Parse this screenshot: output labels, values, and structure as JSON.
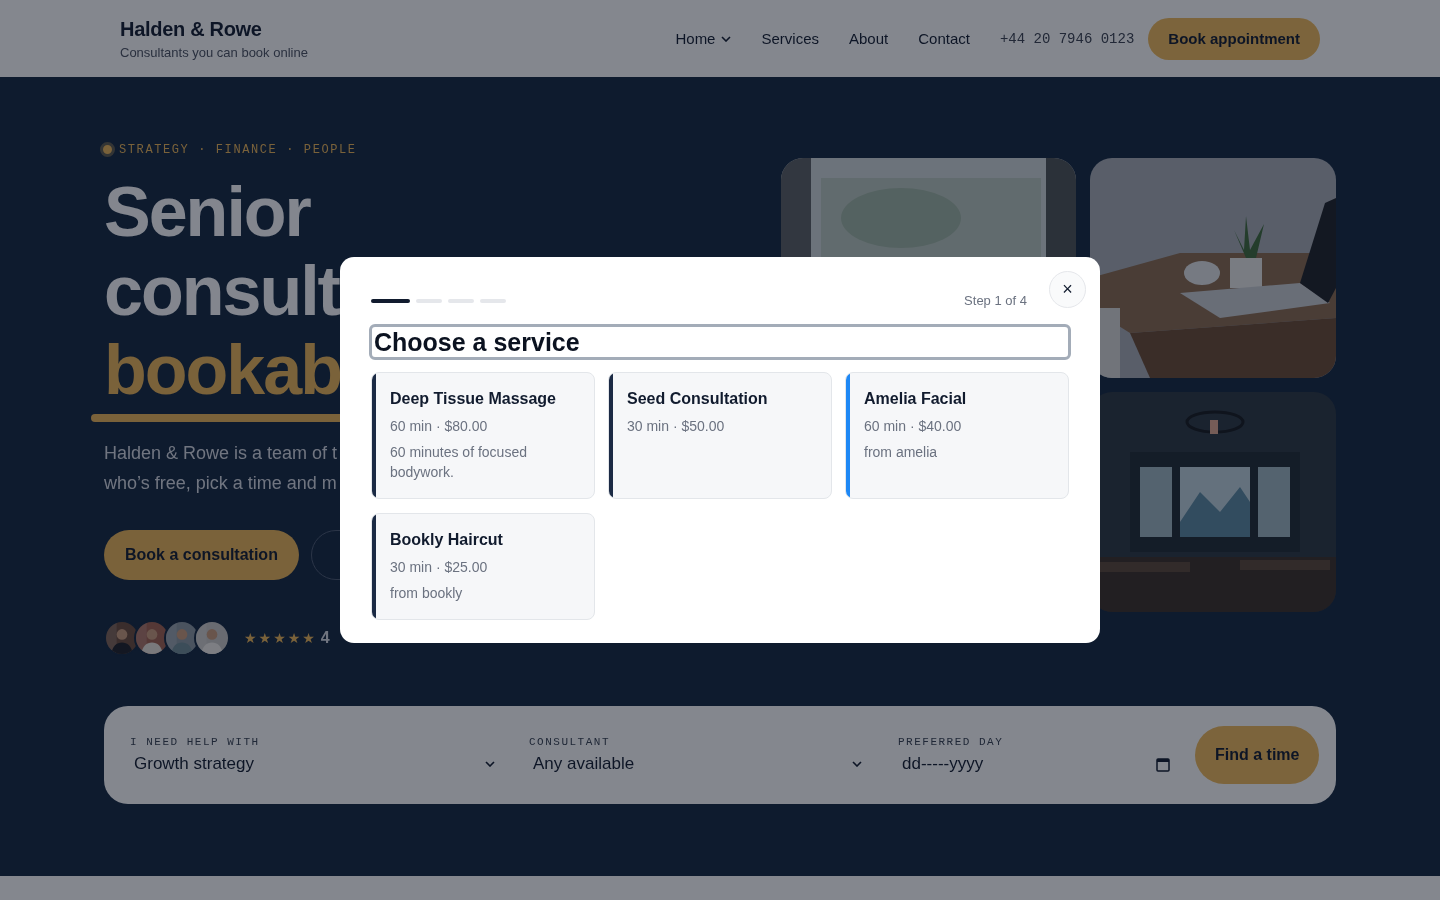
{
  "header": {
    "brand": "Halden & Rowe",
    "tagline": "Consultants you can book online",
    "nav": [
      {
        "label": "Home",
        "has_menu": true
      },
      {
        "label": "Services",
        "has_menu": false
      },
      {
        "label": "About",
        "has_menu": false
      },
      {
        "label": "Contact",
        "has_menu": false
      }
    ],
    "phone": "+44 20 7946 0123",
    "cta": "Book appointment"
  },
  "hero": {
    "eyebrow": "STRATEGY · FINANCE · PEOPLE",
    "title_lines": [
      "Senior",
      "consult"
    ],
    "title_accent": "bookab",
    "intro_lines": [
      "Halden & Rowe is a team of t",
      "who’s free, pick a time and m"
    ],
    "buttons": [
      {
        "label": "Book a consultation",
        "kind": "primary"
      },
      {
        "kind": "outline"
      }
    ],
    "reviewers": [
      {
        "kind": "picture"
      },
      {
        "kind": "picture"
      },
      {
        "kind": "picture"
      },
      {
        "kind": "picture"
      }
    ],
    "rating": {
      "stars": 5,
      "score": "4"
    },
    "photos": [
      {
        "kind": "picture"
      },
      {
        "kind": "picture"
      },
      {
        "kind": "picture"
      }
    ]
  },
  "search_bar": {
    "fields": [
      {
        "kind": "select",
        "label": "I NEED HELP WITH",
        "value": "Growth strategy"
      },
      {
        "kind": "select",
        "label": "CONSULTANT",
        "value": "Any available"
      },
      {
        "kind": "date",
        "label": "PREFERRED DAY",
        "value": "dd-----yyyy"
      }
    ],
    "button": "Find a time"
  },
  "modal": {
    "progress": [
      {
        "active": true
      },
      {
        "active": false
      },
      {
        "active": false
      },
      {
        "active": false
      }
    ],
    "step": "Step 1 of 4",
    "close": "×",
    "heading": {
      "text": "Choose a service",
      "focused": true
    },
    "services": [
      {
        "name": "Deep Tissue Massage",
        "meta": "60 min · $80.00",
        "note": "60 minutes of focused bodywork.",
        "color": "#1b2a44"
      },
      {
        "name": "Seed Consultation",
        "meta": "30 min · $50.00",
        "color": "#1b2a44"
      },
      {
        "name": "Amelia Facial",
        "meta": "60 min · $40.00",
        "note": "from amelia",
        "color": "#1e88f5"
      },
      {
        "name": "Bookly Haircut",
        "meta": "30 min · $25.00",
        "note": "from bookly",
        "color": "#1b2a44"
      }
    ]
  }
}
